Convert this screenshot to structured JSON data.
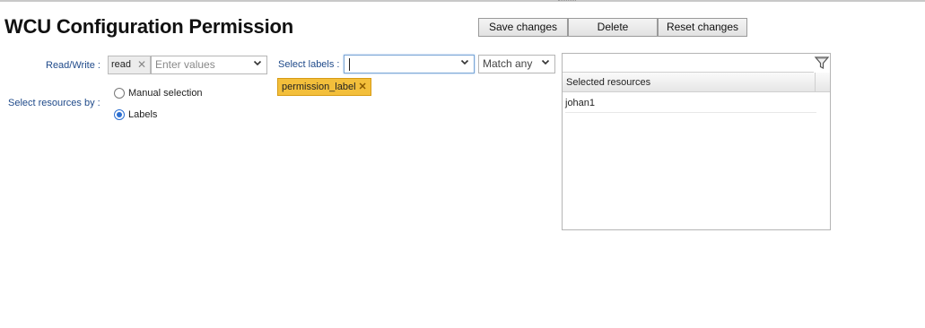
{
  "page": {
    "title": "WCU Configuration Permission"
  },
  "toolbar": {
    "save_label": "Save changes",
    "delete_label": "Delete",
    "reset_label": "Reset changes"
  },
  "read_write": {
    "label": "Read/Write :",
    "selected_value": "read",
    "placeholder": "Enter values"
  },
  "labels_filter": {
    "label": "Select labels :",
    "value": "",
    "match_mode": "Match any",
    "selected_tags": [
      "permission_label"
    ]
  },
  "resources_by": {
    "label": "Select resources by :",
    "options": [
      {
        "label": "Manual selection",
        "checked": false
      },
      {
        "label": "Labels",
        "checked": true
      }
    ]
  },
  "resource_panel": {
    "search_value": "",
    "column_header": "Selected resources",
    "rows": [
      "johan1"
    ],
    "filter_icon": "filter-icon"
  },
  "colors": {
    "label_blue": "#1f4a8a",
    "tag_yellow": "#f3bf3b",
    "radio_blue": "#2c6fd1"
  }
}
